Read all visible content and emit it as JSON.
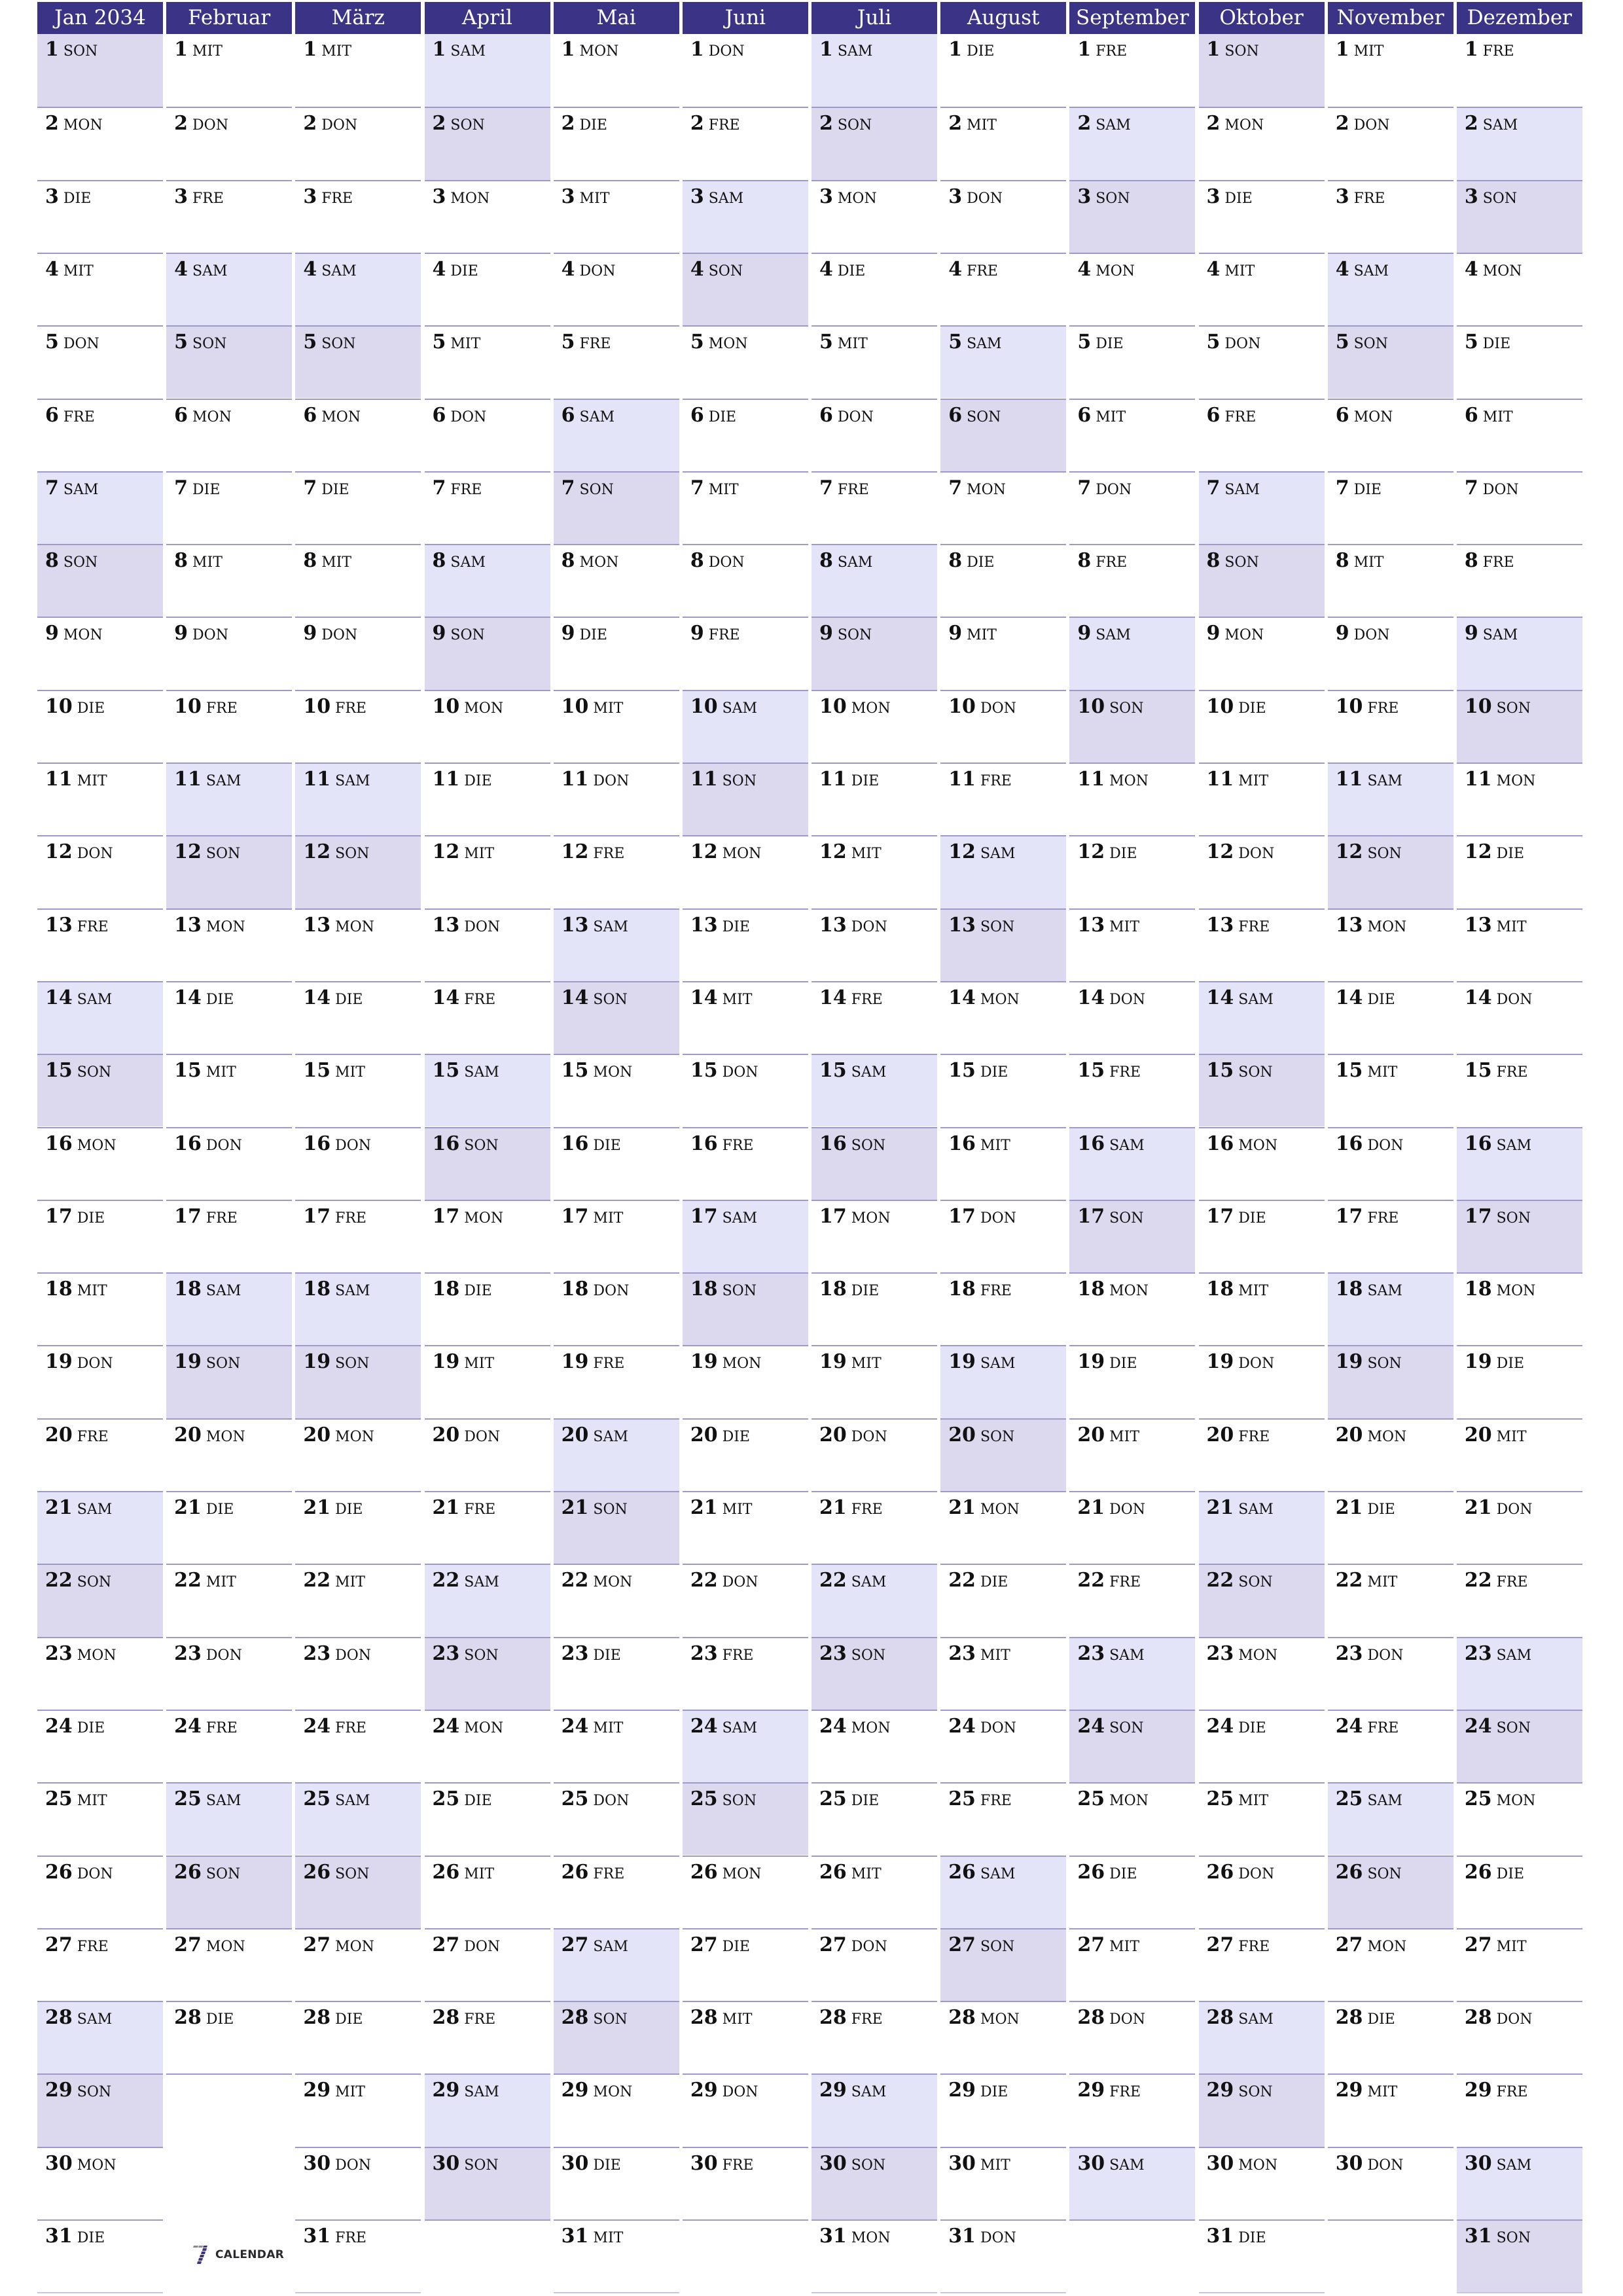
{
  "document": {
    "year": "2034",
    "weekday_abbr": [
      "MON",
      "DIE",
      "MIT",
      "DON",
      "FRE",
      "SAM",
      "SON"
    ],
    "colors": {
      "header_bg": "#3b3386",
      "header_text": "#ffffff",
      "saturday_bg": "#e4e4f8",
      "sunday_bg": "#dcd8ee",
      "row_line": "#9d99c8"
    },
    "months": [
      {
        "label": "Jan 2034",
        "start_weekday": "SON",
        "days_in_month": 31
      },
      {
        "label": "Februar",
        "start_weekday": "MIT",
        "days_in_month": 28
      },
      {
        "label": "März",
        "start_weekday": "MIT",
        "days_in_month": 31
      },
      {
        "label": "April",
        "start_weekday": "SAM",
        "days_in_month": 30
      },
      {
        "label": "Mai",
        "start_weekday": "MON",
        "days_in_month": 31
      },
      {
        "label": "Juni",
        "start_weekday": "DON",
        "days_in_month": 30
      },
      {
        "label": "Juli",
        "start_weekday": "SAM",
        "days_in_month": 31
      },
      {
        "label": "August",
        "start_weekday": "DIE",
        "days_in_month": 31
      },
      {
        "label": "September",
        "start_weekday": "FRE",
        "days_in_month": 30
      },
      {
        "label": "Oktober",
        "start_weekday": "SON",
        "days_in_month": 31
      },
      {
        "label": "November",
        "start_weekday": "MIT",
        "days_in_month": 30
      },
      {
        "label": "Dezember",
        "start_weekday": "FRE",
        "days_in_month": 31
      }
    ]
  },
  "logo": {
    "icon": "seven-calendar-icon",
    "text": "CALENDAR"
  }
}
